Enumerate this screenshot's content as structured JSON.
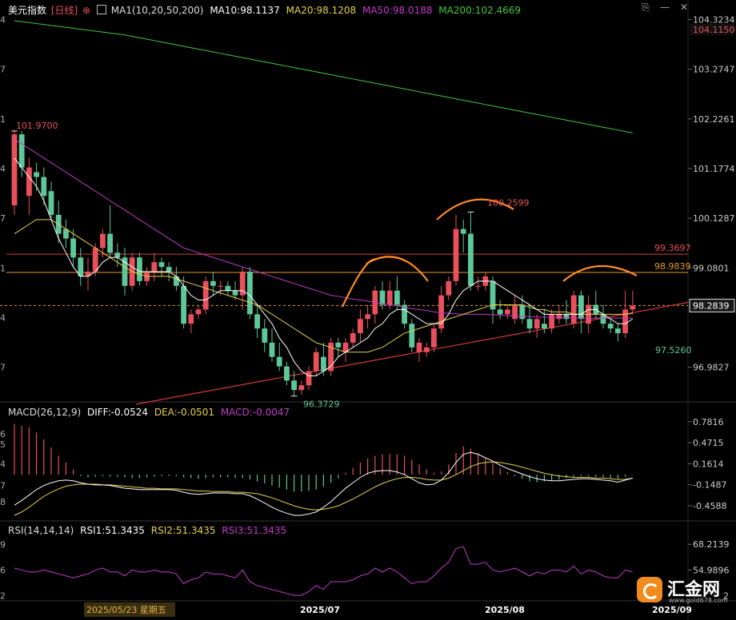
{
  "header": {
    "symbol": "美元指数",
    "period": "[日线]",
    "ma_label": "MA1(10,20,50,200)",
    "ma10": "MA10:98.1137",
    "ma20": "MA20:98.1208",
    "ma50": "MA50:98.0188",
    "ma200": "MA200:102.4669"
  },
  "macd_header": {
    "label": "MACD(26,12,9)",
    "diff": "DIFF:-0.0524",
    "dea": "DEA:-0.0501",
    "macd": "MACD:-0.0047"
  },
  "rsi_header": {
    "label": "RSI(14,14,14)",
    "rsi1": "RSI1:51.3435",
    "rsi2": "RSI2:51.3435",
    "rsi3": "RSI3:51.3435"
  },
  "price_axis": {
    "ticks": [
      "104.3234",
      "103.2747",
      "102.2261",
      "101.1774",
      "100.1287",
      "99.0801",
      "96.9827"
    ],
    "left_ticks": [
      "4",
      "7",
      "1",
      "4",
      "7",
      "1",
      "4",
      "7"
    ],
    "max_tag": "104.1150",
    "current_tag": "98.2839"
  },
  "macd_axis": {
    "ticks": [
      "0.7816",
      "0.4715",
      "0.1614",
      "-0.1487",
      "-0.4588"
    ],
    "left_ticks": [
      "6",
      "5",
      "4",
      "7",
      "8"
    ]
  },
  "rsi_axis": {
    "ticks": [
      "68.2139",
      "54.9896"
    ],
    "left_ticks": [
      "9",
      "6",
      "2"
    ],
    "partial_tick": "2"
  },
  "x_axis": {
    "cursor_date": "2025/05/23 星期五",
    "labels": [
      "2025/07",
      "2025/08",
      "2025/09"
    ]
  },
  "annotations": {
    "high_start": "101.9700",
    "low_july": "96.3729",
    "high_aug": "100.2599",
    "resistance1": "99.3697",
    "resistance2": "98.9839",
    "recent_low": "97.5260"
  },
  "logo": {
    "text": "汇金网",
    "url_text": "www.gold678.com"
  },
  "colors": {
    "up": "#e8505b",
    "down": "#5ec79a",
    "ma10": "#ffffff",
    "ma20": "#e6d24a",
    "ma50": "#c13ac9",
    "ma200": "#3fc83a",
    "resistance": "#d43a3a",
    "orange_line": "#e39a2b",
    "macd_diff": "#ffffff",
    "macd_dea": "#e6d24a",
    "rsi": "#c13ac9",
    "head_shoulder": "#ff8a2a"
  },
  "chart_data": {
    "type": "candlestick",
    "ylim": [
      96.3,
      104.4
    ],
    "candles": [
      {
        "o": 100.4,
        "h": 102.0,
        "l": 100.2,
        "c": 101.9
      },
      {
        "o": 101.9,
        "h": 101.97,
        "l": 101.0,
        "c": 101.2
      },
      {
        "o": 100.6,
        "h": 101.4,
        "l": 100.2,
        "c": 101.2
      },
      {
        "o": 101.1,
        "h": 101.3,
        "l": 100.7,
        "c": 101.0
      },
      {
        "o": 101.0,
        "h": 101.2,
        "l": 100.4,
        "c": 100.6
      },
      {
        "o": 100.7,
        "h": 100.9,
        "l": 100.1,
        "c": 100.2
      },
      {
        "o": 100.2,
        "h": 100.5,
        "l": 99.6,
        "c": 99.8
      },
      {
        "o": 99.9,
        "h": 100.1,
        "l": 99.5,
        "c": 99.7
      },
      {
        "o": 99.7,
        "h": 99.9,
        "l": 99.1,
        "c": 99.3
      },
      {
        "o": 99.3,
        "h": 99.5,
        "l": 98.7,
        "c": 98.9
      },
      {
        "o": 98.9,
        "h": 99.3,
        "l": 98.6,
        "c": 99.0
      },
      {
        "o": 99.0,
        "h": 99.6,
        "l": 98.9,
        "c": 99.5
      },
      {
        "o": 99.5,
        "h": 99.9,
        "l": 99.3,
        "c": 99.8
      },
      {
        "o": 99.8,
        "h": 100.4,
        "l": 99.3,
        "c": 99.4
      },
      {
        "o": 99.4,
        "h": 99.6,
        "l": 99.1,
        "c": 99.3
      },
      {
        "o": 99.3,
        "h": 99.5,
        "l": 98.5,
        "c": 98.7
      },
      {
        "o": 98.7,
        "h": 99.4,
        "l": 98.6,
        "c": 99.3
      },
      {
        "o": 99.3,
        "h": 99.4,
        "l": 98.7,
        "c": 98.8
      },
      {
        "o": 98.8,
        "h": 99.1,
        "l": 98.7,
        "c": 99.0
      },
      {
        "o": 99.0,
        "h": 99.4,
        "l": 98.8,
        "c": 99.2
      },
      {
        "o": 99.2,
        "h": 99.3,
        "l": 98.9,
        "c": 99.1
      },
      {
        "o": 99.1,
        "h": 99.2,
        "l": 98.8,
        "c": 99.0
      },
      {
        "o": 98.9,
        "h": 99.1,
        "l": 98.6,
        "c": 98.7
      },
      {
        "o": 98.7,
        "h": 98.9,
        "l": 97.8,
        "c": 97.9
      },
      {
        "o": 97.9,
        "h": 98.2,
        "l": 97.7,
        "c": 98.1
      },
      {
        "o": 98.1,
        "h": 98.3,
        "l": 98.0,
        "c": 98.2
      },
      {
        "o": 98.2,
        "h": 98.9,
        "l": 98.1,
        "c": 98.8
      },
      {
        "o": 98.8,
        "h": 99.0,
        "l": 98.5,
        "c": 98.7
      },
      {
        "o": 98.7,
        "h": 98.8,
        "l": 98.5,
        "c": 98.7
      },
      {
        "o": 98.7,
        "h": 98.8,
        "l": 98.5,
        "c": 98.6
      },
      {
        "o": 98.6,
        "h": 98.8,
        "l": 98.4,
        "c": 98.5
      },
      {
        "o": 98.5,
        "h": 99.1,
        "l": 98.2,
        "c": 99.0
      },
      {
        "o": 99.0,
        "h": 99.1,
        "l": 98.0,
        "c": 98.1
      },
      {
        "o": 98.1,
        "h": 98.3,
        "l": 97.6,
        "c": 97.8
      },
      {
        "o": 97.8,
        "h": 98.0,
        "l": 97.3,
        "c": 97.5
      },
      {
        "o": 97.5,
        "h": 97.8,
        "l": 97.1,
        "c": 97.2
      },
      {
        "o": 97.2,
        "h": 97.5,
        "l": 96.9,
        "c": 97.0
      },
      {
        "o": 97.0,
        "h": 97.1,
        "l": 96.6,
        "c": 96.7
      },
      {
        "o": 96.7,
        "h": 96.9,
        "l": 96.37,
        "c": 96.5
      },
      {
        "o": 96.5,
        "h": 96.7,
        "l": 96.4,
        "c": 96.6
      },
      {
        "o": 96.6,
        "h": 97.0,
        "l": 96.5,
        "c": 96.9
      },
      {
        "o": 96.9,
        "h": 97.4,
        "l": 96.8,
        "c": 97.3
      },
      {
        "o": 97.2,
        "h": 97.5,
        "l": 96.8,
        "c": 96.9
      },
      {
        "o": 96.9,
        "h": 97.6,
        "l": 96.8,
        "c": 97.5
      },
      {
        "o": 97.5,
        "h": 97.6,
        "l": 97.2,
        "c": 97.4
      },
      {
        "o": 97.3,
        "h": 97.6,
        "l": 97.1,
        "c": 97.5
      },
      {
        "o": 97.5,
        "h": 97.8,
        "l": 97.4,
        "c": 97.7
      },
      {
        "o": 97.7,
        "h": 98.2,
        "l": 97.5,
        "c": 98.0
      },
      {
        "o": 98.0,
        "h": 98.3,
        "l": 97.8,
        "c": 98.1
      },
      {
        "o": 98.1,
        "h": 98.7,
        "l": 97.9,
        "c": 98.6
      },
      {
        "o": 98.6,
        "h": 98.8,
        "l": 98.2,
        "c": 98.3
      },
      {
        "o": 98.3,
        "h": 98.8,
        "l": 98.2,
        "c": 98.6
      },
      {
        "o": 98.6,
        "h": 98.9,
        "l": 98.2,
        "c": 98.3
      },
      {
        "o": 98.3,
        "h": 98.4,
        "l": 97.8,
        "c": 97.9
      },
      {
        "o": 97.9,
        "h": 98.0,
        "l": 97.3,
        "c": 97.4
      },
      {
        "o": 97.3,
        "h": 97.6,
        "l": 97.1,
        "c": 97.5
      },
      {
        "o": 97.3,
        "h": 97.5,
        "l": 97.2,
        "c": 97.4
      },
      {
        "o": 97.4,
        "h": 97.9,
        "l": 97.3,
        "c": 97.8
      },
      {
        "o": 97.8,
        "h": 98.7,
        "l": 97.7,
        "c": 98.5
      },
      {
        "o": 98.5,
        "h": 98.9,
        "l": 98.4,
        "c": 98.8
      },
      {
        "o": 98.8,
        "h": 100.2,
        "l": 98.7,
        "c": 99.9
      },
      {
        "o": 99.9,
        "h": 100.1,
        "l": 99.4,
        "c": 99.8
      },
      {
        "o": 99.8,
        "h": 100.26,
        "l": 98.6,
        "c": 98.7
      },
      {
        "o": 98.7,
        "h": 98.9,
        "l": 98.6,
        "c": 98.7
      },
      {
        "o": 98.7,
        "h": 99.0,
        "l": 98.6,
        "c": 98.9
      },
      {
        "o": 98.8,
        "h": 98.9,
        "l": 97.9,
        "c": 98.2
      },
      {
        "o": 98.2,
        "h": 98.4,
        "l": 98.0,
        "c": 98.1
      },
      {
        "o": 98.1,
        "h": 98.3,
        "l": 98.0,
        "c": 98.2
      },
      {
        "o": 98.0,
        "h": 98.5,
        "l": 97.9,
        "c": 98.3
      },
      {
        "o": 98.3,
        "h": 98.5,
        "l": 97.9,
        "c": 98.0
      },
      {
        "o": 98.0,
        "h": 98.3,
        "l": 97.7,
        "c": 97.8
      },
      {
        "o": 97.8,
        "h": 98.1,
        "l": 97.6,
        "c": 98.0
      },
      {
        "o": 97.9,
        "h": 98.2,
        "l": 97.7,
        "c": 97.8
      },
      {
        "o": 97.8,
        "h": 98.2,
        "l": 97.7,
        "c": 98.1
      },
      {
        "o": 98.0,
        "h": 98.3,
        "l": 97.9,
        "c": 98.1
      },
      {
        "o": 98.1,
        "h": 98.4,
        "l": 97.9,
        "c": 98.0
      },
      {
        "o": 97.9,
        "h": 98.6,
        "l": 97.8,
        "c": 98.5
      },
      {
        "o": 98.5,
        "h": 98.6,
        "l": 97.7,
        "c": 98.0
      },
      {
        "o": 97.9,
        "h": 98.5,
        "l": 97.7,
        "c": 98.3
      },
      {
        "o": 98.3,
        "h": 98.6,
        "l": 98.0,
        "c": 98.1
      },
      {
        "o": 98.1,
        "h": 98.3,
        "l": 97.8,
        "c": 97.9
      },
      {
        "o": 97.9,
        "h": 98.0,
        "l": 97.7,
        "c": 97.8
      },
      {
        "o": 97.8,
        "h": 97.9,
        "l": 97.53,
        "c": 97.7
      },
      {
        "o": 97.7,
        "h": 98.6,
        "l": 97.6,
        "c": 98.2
      },
      {
        "o": 98.2,
        "h": 98.6,
        "l": 98.1,
        "c": 98.28
      }
    ],
    "ma10": [
      101.4,
      101.2,
      101.0,
      100.8,
      100.5,
      100.1,
      99.7,
      99.4,
      99.1,
      98.9,
      98.9,
      99.0,
      99.2,
      99.3,
      99.3,
      99.2,
      99.1,
      99.0,
      99.0,
      99.0,
      99.0,
      99.0,
      98.9,
      98.7,
      98.5,
      98.4,
      98.4,
      98.5,
      98.6,
      98.6,
      98.6,
      98.6,
      98.5,
      98.3,
      98.1,
      97.9,
      97.6,
      97.4,
      97.1,
      96.9,
      96.8,
      96.8,
      96.9,
      97.0,
      97.2,
      97.3,
      97.4,
      97.5,
      97.6,
      97.8,
      97.9,
      98.1,
      98.2,
      98.2,
      98.1,
      98.0,
      97.9,
      97.9,
      97.9,
      98.1,
      98.4,
      98.6,
      98.7,
      98.8,
      98.8,
      98.8,
      98.7,
      98.6,
      98.5,
      98.4,
      98.3,
      98.2,
      98.1,
      98.1,
      98.1,
      98.1,
      98.1,
      98.1,
      98.2,
      98.2,
      98.1,
      98.0,
      97.9,
      97.9,
      98.0
    ],
    "ma20": [
      99.8,
      99.9,
      100.0,
      100.1,
      100.1,
      100.1,
      100.0,
      99.9,
      99.8,
      99.7,
      99.6,
      99.5,
      99.4,
      99.3,
      99.2,
      99.1,
      99.0,
      98.95,
      98.9,
      98.9,
      98.9,
      98.9,
      98.85,
      98.8,
      98.75,
      98.7,
      98.65,
      98.6,
      98.55,
      98.5,
      98.45,
      98.4,
      98.35,
      98.3,
      98.2,
      98.1,
      98.0,
      97.9,
      97.8,
      97.7,
      97.6,
      97.5,
      97.45,
      97.4,
      97.35,
      97.3,
      97.3,
      97.3,
      97.3,
      97.35,
      97.4,
      97.5,
      97.6,
      97.7,
      97.75,
      97.8,
      97.85,
      97.9,
      97.95,
      98.0,
      98.05,
      98.1,
      98.15,
      98.2,
      98.25,
      98.3,
      98.3,
      98.3,
      98.3,
      98.3,
      98.25,
      98.2,
      98.2,
      98.15,
      98.15,
      98.15,
      98.1,
      98.1,
      98.1,
      98.1,
      98.1,
      98.1,
      98.1,
      98.1,
      98.12
    ],
    "ma50": [
      101.8,
      101.7,
      101.6,
      101.5,
      101.4,
      101.3,
      101.2,
      101.1,
      101.0,
      100.9,
      100.8,
      100.7,
      100.6,
      100.5,
      100.4,
      100.3,
      100.2,
      100.1,
      100.0,
      99.9,
      99.8,
      99.7,
      99.6,
      99.5,
      99.45,
      99.4,
      99.35,
      99.3,
      99.25,
      99.2,
      99.15,
      99.1,
      99.05,
      99.0,
      98.95,
      98.9,
      98.85,
      98.8,
      98.75,
      98.7,
      98.65,
      98.6,
      98.55,
      98.5,
      98.48,
      98.45,
      98.42,
      98.4,
      98.38,
      98.35,
      98.32,
      98.3,
      98.28,
      98.25,
      98.22,
      98.2,
      98.18,
      98.15,
      98.13,
      98.12,
      98.11,
      98.1,
      98.1,
      98.1,
      98.1,
      98.09,
      98.08,
      98.07,
      98.06,
      98.05,
      98.05,
      98.04,
      98.04,
      98.03,
      98.03,
      98.03,
      98.02,
      98.02,
      98.02,
      98.02,
      98.02,
      98.02,
      98.02,
      98.02,
      98.02
    ],
    "ma200": [
      104.3,
      104.28,
      104.26,
      104.24,
      104.22,
      104.2,
      104.18,
      104.16,
      104.14,
      104.12,
      104.1,
      104.08,
      104.06,
      104.04,
      104.02,
      104.0,
      103.97,
      103.94,
      103.91,
      103.88,
      103.85,
      103.82,
      103.79,
      103.76,
      103.73,
      103.7,
      103.67,
      103.64,
      103.61,
      103.58,
      103.55,
      103.52,
      103.49,
      103.46,
      103.43,
      103.4,
      103.37,
      103.34,
      103.31,
      103.28,
      103.25,
      103.22,
      103.19,
      103.16,
      103.13,
      103.1,
      103.07,
      103.04,
      103.01,
      102.98,
      102.95,
      102.92,
      102.89,
      102.86,
      102.83,
      102.8,
      102.77,
      102.74,
      102.71,
      102.68,
      102.65,
      102.62,
      102.59,
      102.56,
      102.53,
      102.5,
      102.47,
      102.44,
      102.41,
      102.38,
      102.35,
      102.32,
      102.29,
      102.26,
      102.23,
      102.2,
      102.17,
      102.14,
      102.11,
      102.08,
      102.05,
      102.02,
      101.99,
      101.96,
      101.93
    ],
    "macd_ylim": [
      -0.6,
      0.85
    ],
    "macd_hist": [
      0.75,
      0.72,
      0.7,
      0.62,
      0.52,
      0.4,
      0.28,
      0.18,
      0.08,
      -0.02,
      -0.04,
      -0.03,
      -0.02,
      -0.03,
      -0.03,
      -0.04,
      -0.05,
      -0.05,
      -0.04,
      -0.03,
      -0.02,
      -0.02,
      -0.02,
      -0.04,
      -0.05,
      -0.06,
      -0.05,
      -0.04,
      -0.04,
      -0.04,
      -0.05,
      -0.05,
      -0.07,
      -0.1,
      -0.13,
      -0.16,
      -0.19,
      -0.22,
      -0.25,
      -0.25,
      -0.24,
      -0.22,
      -0.18,
      -0.12,
      -0.05,
      0.03,
      0.1,
      0.18,
      0.24,
      0.28,
      0.3,
      0.31,
      0.3,
      0.28,
      0.22,
      0.15,
      0.08,
      0.03,
      0.05,
      0.15,
      0.32,
      0.42,
      0.38,
      0.32,
      0.25,
      0.18,
      0.1,
      0.04,
      -0.02,
      -0.06,
      -0.1,
      -0.11,
      -0.1,
      -0.09,
      -0.07,
      -0.05,
      -0.03,
      -0.02,
      -0.02,
      -0.03,
      -0.04,
      -0.05,
      -0.06,
      -0.03,
      -0.005
    ],
    "macd_diff": [
      -0.45,
      -0.38,
      -0.3,
      -0.22,
      -0.16,
      -0.12,
      -0.09,
      -0.08,
      -0.09,
      -0.12,
      -0.14,
      -0.15,
      -0.15,
      -0.16,
      -0.18,
      -0.2,
      -0.21,
      -0.22,
      -0.22,
      -0.22,
      -0.22,
      -0.22,
      -0.23,
      -0.26,
      -0.28,
      -0.29,
      -0.28,
      -0.27,
      -0.27,
      -0.27,
      -0.28,
      -0.28,
      -0.31,
      -0.36,
      -0.42,
      -0.48,
      -0.53,
      -0.57,
      -0.6,
      -0.6,
      -0.58,
      -0.55,
      -0.48,
      -0.4,
      -0.3,
      -0.2,
      -0.12,
      -0.04,
      0.02,
      0.05,
      0.06,
      0.06,
      0.04,
      0.0,
      -0.06,
      -0.12,
      -0.15,
      -0.14,
      -0.08,
      0.03,
      0.18,
      0.3,
      0.33,
      0.3,
      0.25,
      0.2,
      0.14,
      0.09,
      0.05,
      0.01,
      -0.03,
      -0.06,
      -0.08,
      -0.09,
      -0.09,
      -0.08,
      -0.07,
      -0.06,
      -0.06,
      -0.07,
      -0.08,
      -0.09,
      -0.11,
      -0.08,
      -0.05
    ],
    "macd_dea": [
      -0.6,
      -0.55,
      -0.48,
      -0.4,
      -0.32,
      -0.26,
      -0.21,
      -0.17,
      -0.15,
      -0.14,
      -0.14,
      -0.14,
      -0.15,
      -0.15,
      -0.16,
      -0.17,
      -0.18,
      -0.19,
      -0.2,
      -0.2,
      -0.21,
      -0.21,
      -0.21,
      -0.22,
      -0.23,
      -0.24,
      -0.24,
      -0.25,
      -0.25,
      -0.25,
      -0.26,
      -0.26,
      -0.27,
      -0.28,
      -0.31,
      -0.34,
      -0.38,
      -0.42,
      -0.46,
      -0.49,
      -0.51,
      -0.52,
      -0.51,
      -0.49,
      -0.46,
      -0.41,
      -0.36,
      -0.3,
      -0.24,
      -0.18,
      -0.13,
      -0.09,
      -0.06,
      -0.04,
      -0.04,
      -0.05,
      -0.07,
      -0.08,
      -0.08,
      -0.05,
      0.0,
      0.06,
      0.12,
      0.16,
      0.18,
      0.19,
      0.18,
      0.16,
      0.14,
      0.11,
      0.08,
      0.05,
      0.02,
      0.0,
      -0.02,
      -0.03,
      -0.04,
      -0.04,
      -0.04,
      -0.05,
      -0.05,
      -0.06,
      -0.07,
      -0.07,
      -0.05
    ],
    "rsi_ylim": [
      40,
      72
    ],
    "rsi": [
      56,
      55,
      54,
      54,
      55,
      54,
      53,
      52,
      51,
      52,
      53,
      55,
      56,
      54,
      54,
      52,
      55,
      54,
      54,
      55,
      54,
      54,
      53,
      48,
      50,
      51,
      54,
      53,
      53,
      52,
      51,
      55,
      49,
      47,
      46,
      45,
      44,
      43,
      42,
      42,
      44,
      47,
      45,
      49,
      49,
      49,
      50,
      52,
      53,
      56,
      54,
      56,
      54,
      51,
      48,
      49,
      49,
      52,
      56,
      59,
      66,
      67,
      58,
      58,
      59,
      55,
      54,
      55,
      56,
      54,
      52,
      54,
      53,
      55,
      55,
      54,
      57,
      53,
      55,
      54,
      52,
      51,
      51,
      55,
      54
    ]
  }
}
